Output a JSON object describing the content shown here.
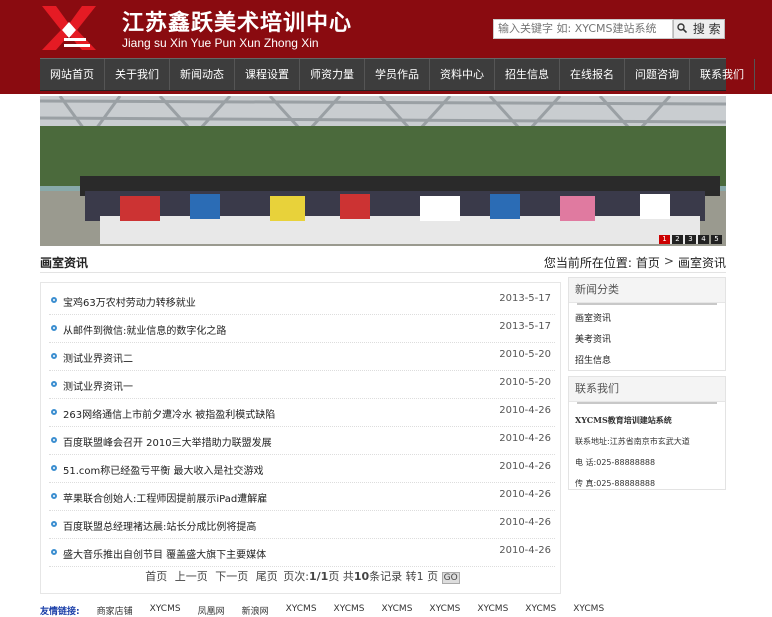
{
  "header": {
    "title": "江苏鑫跃美术培训中心",
    "subtitle": "Jiang su Xin Yue Pun Xun Zhong Xin",
    "logo_color": "#e51b24",
    "bg_color": "#8a0b10"
  },
  "search": {
    "placeholder": "输入关键字 如: XYCMS建站系统",
    "button_label": "搜 索",
    "button_icon": "search-icon"
  },
  "nav": {
    "items": [
      "网站首页",
      "关于我们",
      "新闻动态",
      "课程设置",
      "师资力量",
      "学员作品",
      "资料中心",
      "招生信息",
      "在线报名",
      "问题咨询",
      "联系我们"
    ]
  },
  "banner": {
    "pages": [
      "1",
      "2",
      "3",
      "4",
      "5"
    ],
    "active_page": "1"
  },
  "section": {
    "title": "画室资讯",
    "breadcrumb_prefix": "您当前所在位置:",
    "breadcrumb_home": "首页",
    "breadcrumb_sep": ">",
    "breadcrumb_current": "画室资讯"
  },
  "news": [
    {
      "title": "宝鸡63万农村劳动力转移就业",
      "date": "2013-5-17"
    },
    {
      "title": "从邮件到微信:就业信息的数字化之路",
      "date": "2013-5-17"
    },
    {
      "title": "测试业界资讯二",
      "date": "2010-5-20"
    },
    {
      "title": "测试业界资讯一",
      "date": "2010-5-20"
    },
    {
      "title": "263网络通信上市前夕遭冷水 被指盈利模式缺陷",
      "date": "2010-4-26"
    },
    {
      "title": "百度联盟峰会召开 2010三大举措助力联盟发展",
      "date": "2010-4-26"
    },
    {
      "title": "51.com称已经盈亏平衡 最大收入是社交游戏",
      "date": "2010-4-26"
    },
    {
      "title": "苹果联合创始人:工程师因提前展示iPad遭解雇",
      "date": "2010-4-26"
    },
    {
      "title": "百度联盟总经理褚达晨:站长分成比例将提高",
      "date": "2010-4-26"
    },
    {
      "title": "盛大音乐推出自创节目 覆盖盛大旗下主要媒体",
      "date": "2010-4-26"
    }
  ],
  "pager": {
    "first": "首页",
    "prev": "上一页",
    "next": "下一页",
    "last": "尾页",
    "page_label": "页次:",
    "page_value": "1/1",
    "page_unit": "页",
    "total_prefix": "共",
    "total_value": "10",
    "total_suffix": "条记录",
    "goto_prefix": "转",
    "goto_value": "1",
    "goto_suffix": "页",
    "go_label": "GO"
  },
  "sidebar": {
    "news_category": {
      "title": "新闻分类",
      "items": [
        "画室资讯",
        "美考资讯",
        "招生信息"
      ]
    },
    "contact": {
      "title": "联系我们",
      "org": "XYCMS教育培训建站系统",
      "address": "联系地址:江苏省南京市玄武大道",
      "phone": "电 话:025-88888888",
      "fax": "传 真:025-88888888"
    }
  },
  "friends": {
    "label": "友情链接:",
    "items": [
      "商家店铺",
      "XYCMS",
      "凤凰网",
      "新浪网",
      "XYCMS",
      "XYCMS",
      "XYCMS",
      "XYCMS",
      "XYCMS",
      "XYCMS",
      "XYCMS"
    ]
  }
}
